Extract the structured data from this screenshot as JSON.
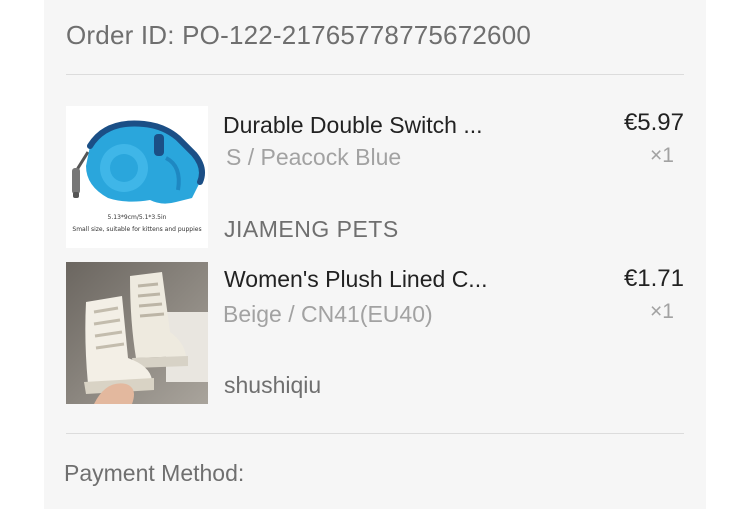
{
  "order": {
    "id_text": "Order ID: PO-122-21765778775672600"
  },
  "items": [
    {
      "title": "Durable Double Switch ...",
      "variant": "S / Peacock Blue",
      "price": "€5.97",
      "quantity": "×1",
      "image_caption_line1": "5.13*9cm/5.1*3.5in",
      "image_caption_line2": "Small size, suitable for kittens and puppies"
    },
    {
      "title": "Women's Plush Lined C...",
      "variant": "Beige / CN41(EU40)",
      "price": "€1.71",
      "quantity": "×1"
    }
  ],
  "stores": [
    {
      "name": "JIAMENG PETS"
    },
    {
      "name": "shushiqiu"
    }
  ],
  "payment": {
    "label": "Payment Method:"
  },
  "colors": {
    "background": "#ffffff",
    "card": "#f6f6f6",
    "text_primary": "#222222",
    "text_secondary": "#6f6f6f",
    "text_muted": "#a2a2a2",
    "divider": "#dcdcdc",
    "leash_blue": "#2aa6dc"
  }
}
